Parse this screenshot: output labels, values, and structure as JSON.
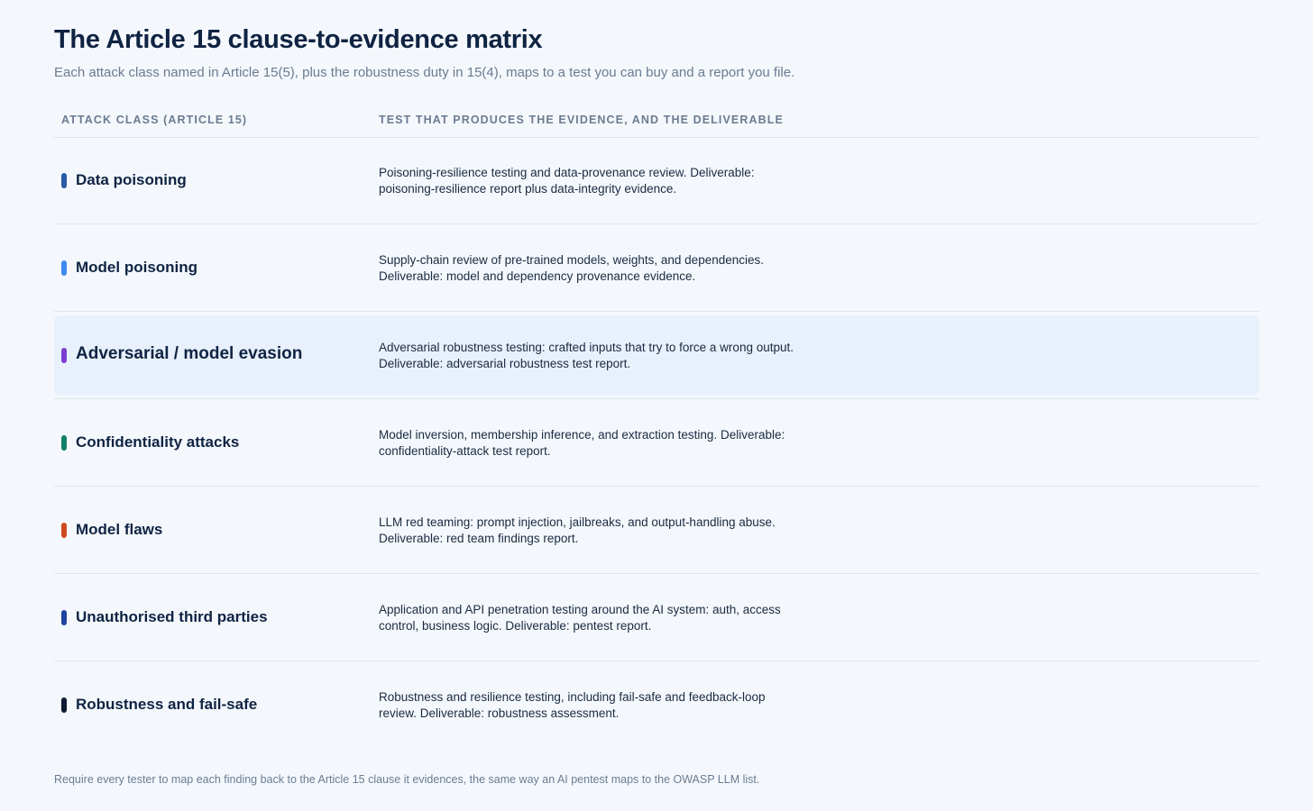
{
  "title": "The Article 15 clause-to-evidence matrix",
  "subtitle": "Each attack class named in Article 15(5), plus the robustness duty in 15(4), maps to a test you can buy and a report you file.",
  "table": {
    "headers": {
      "attack_class": "ATTACK CLASS (ARTICLE 15)",
      "test": "TEST THAT PRODUCES THE EVIDENCE, AND THE DELIVERABLE"
    },
    "rows": [
      {
        "name": "Data poisoning",
        "description": "Poisoning-resilience testing and data-provenance review. Deliverable: poisoning-resilience report plus data-integrity evidence.",
        "color": "#2c5aa8",
        "highlight": false
      },
      {
        "name": "Model poisoning",
        "description": "Supply-chain review of pre-trained models, weights, and dependencies. Deliverable: model and dependency provenance evidence.",
        "color": "#3d8bef",
        "highlight": false
      },
      {
        "name": "Adversarial / model evasion",
        "description": "Adversarial robustness testing: crafted inputs that try to force a wrong output. Deliverable: adversarial robustness test report.",
        "color": "#7a3fd0",
        "highlight": true
      },
      {
        "name": "Confidentiality attacks",
        "description": "Model inversion, membership inference, and extraction testing. Deliverable: confidentiality-attack test report.",
        "color": "#137e6a",
        "highlight": false
      },
      {
        "name": "Model flaws",
        "description": "LLM red teaming: prompt injection, jailbreaks, and output-handling abuse. Deliverable: red team findings report.",
        "color": "#d04a1e",
        "highlight": false
      },
      {
        "name": "Unauthorised third parties",
        "description": "Application and API penetration testing around the AI system: auth, access control, business logic. Deliverable: pentest report.",
        "color": "#1e43a0",
        "highlight": false
      },
      {
        "name": "Robustness and fail-safe",
        "description": "Robustness and resilience testing, including fail-safe and feedback-loop review. Deliverable: robustness assessment.",
        "color": "#0f1a33",
        "highlight": false
      }
    ]
  },
  "footnote": "Require every tester to map each finding back to the Article 15 clause it evidences, the same way an AI pentest maps to the OWASP LLM list."
}
